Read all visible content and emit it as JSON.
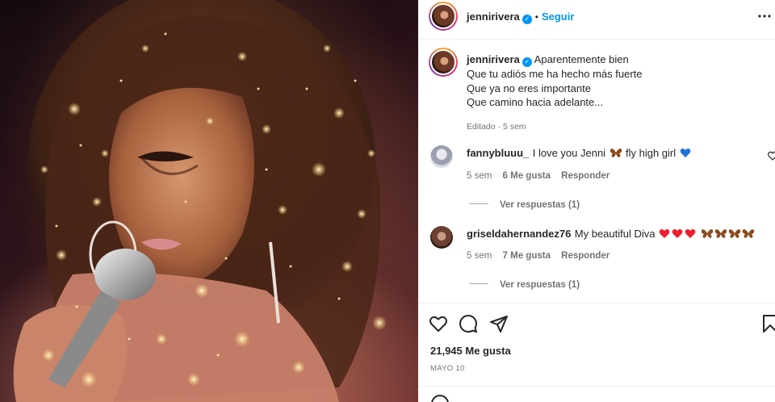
{
  "post": {
    "username": "jennirivera",
    "follow_label": "Seguir",
    "dot": "•",
    "more_icon": "more-horizontal-icon"
  },
  "caption": {
    "username": "jennirivera",
    "lines": [
      "Aparentemente bien",
      "Que tu adiós me ha hecho más fuerte",
      "Que ya no eres importante",
      "Que camino hacia adelante..."
    ],
    "edited": "Editado · 5 sem"
  },
  "comments": [
    {
      "username": "fannybluuu_",
      "text_before": "I love you Jenni",
      "text_middle": "fly high girl",
      "age": "5 sem",
      "likes": "6 Me gusta",
      "reply_label": "Responder",
      "view_replies": "Ver respuestas (1)"
    },
    {
      "username": "griseldahernandez76",
      "text": "My beautiful Diva",
      "age": "5 sem",
      "likes": "7 Me gusta",
      "reply_label": "Responder",
      "view_replies": "Ver respuestas (1)"
    }
  ],
  "actions": {
    "icons": [
      "heart-icon",
      "comment-icon",
      "share-icon",
      "bookmark-icon"
    ]
  },
  "likes_count": "21,945 Me gusta",
  "post_date": "MAYO 10",
  "colors": {
    "accent_blue": "#0095f6",
    "text_primary": "#262626",
    "text_secondary": "#737373",
    "heart_red": "#ed1f2e",
    "butterfly_brown": "#8b4a1c"
  }
}
